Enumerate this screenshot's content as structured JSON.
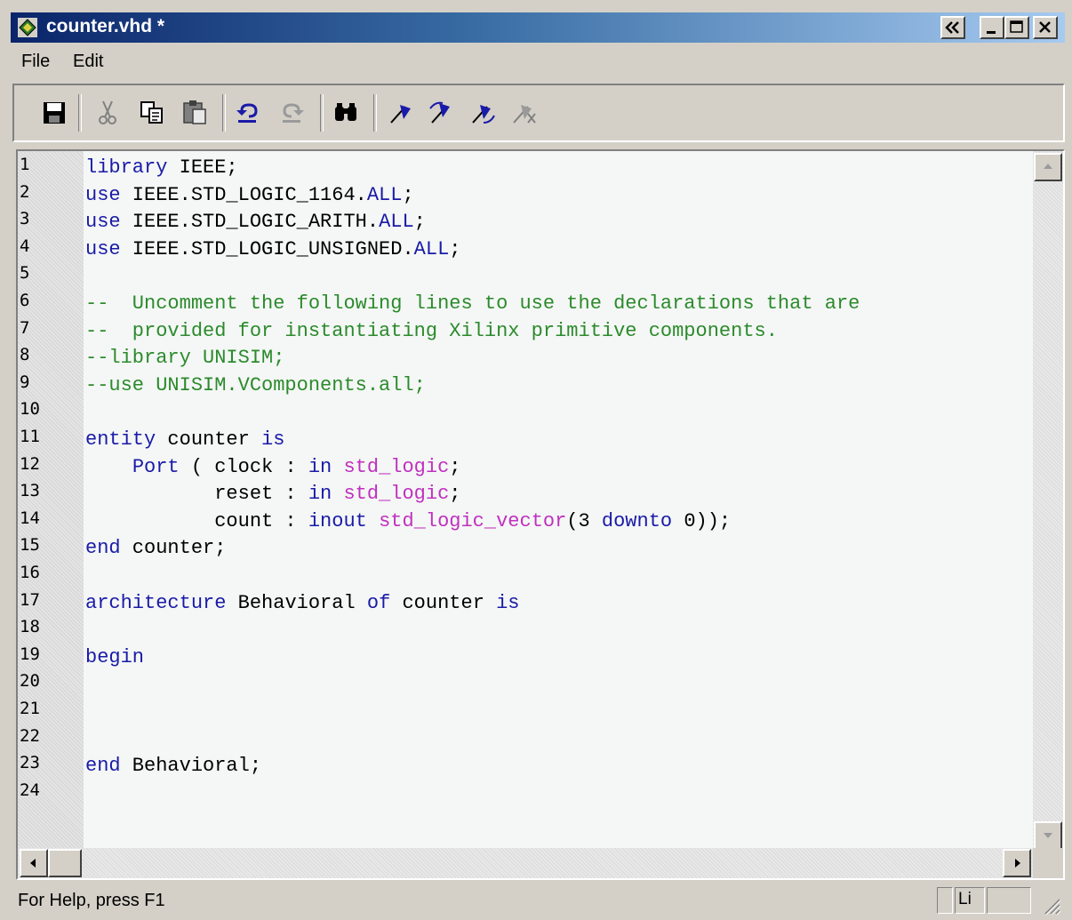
{
  "window": {
    "title": "counter.vhd *",
    "buttons": [
      "collapse",
      "minimize",
      "maximize",
      "close"
    ]
  },
  "menu": {
    "items": [
      "File",
      "Edit"
    ]
  },
  "toolbar": {
    "icons": [
      "save-icon",
      "cut-icon",
      "copy-icon",
      "paste-icon",
      "undo-icon",
      "redo-icon",
      "find-icon",
      "toggle-bookmark-icon",
      "next-bookmark-icon",
      "previous-bookmark-icon",
      "clear-bookmarks-icon"
    ]
  },
  "editor": {
    "line_numbers": [
      "1",
      "2",
      "3",
      "4",
      "5",
      "6",
      "7",
      "8",
      "9",
      "10",
      "11",
      "12",
      "13",
      "14",
      "15",
      "16",
      "17",
      "18",
      "19",
      "20",
      "21",
      "22",
      "23",
      "24"
    ],
    "lines": [
      [
        {
          "t": "kw",
          "v": "library"
        },
        {
          "t": "plain",
          "v": " IEEE;"
        }
      ],
      [
        {
          "t": "kw",
          "v": "use"
        },
        {
          "t": "plain",
          "v": " IEEE.STD_LOGIC_1164."
        },
        {
          "t": "kw",
          "v": "ALL"
        },
        {
          "t": "plain",
          "v": ";"
        }
      ],
      [
        {
          "t": "kw",
          "v": "use"
        },
        {
          "t": "plain",
          "v": " IEEE.STD_LOGIC_ARITH."
        },
        {
          "t": "kw",
          "v": "ALL"
        },
        {
          "t": "plain",
          "v": ";"
        }
      ],
      [
        {
          "t": "kw",
          "v": "use"
        },
        {
          "t": "plain",
          "v": " IEEE.STD_LOGIC_UNSIGNED."
        },
        {
          "t": "kw",
          "v": "ALL"
        },
        {
          "t": "plain",
          "v": ";"
        }
      ],
      [],
      [
        {
          "t": "cmt",
          "v": "--  Uncomment the following lines to use the declarations that are"
        }
      ],
      [
        {
          "t": "cmt",
          "v": "--  provided for instantiating Xilinx primitive components."
        }
      ],
      [
        {
          "t": "cmt",
          "v": "--library UNISIM;"
        }
      ],
      [
        {
          "t": "cmt",
          "v": "--use UNISIM.VComponents.all;"
        }
      ],
      [],
      [
        {
          "t": "kw",
          "v": "entity"
        },
        {
          "t": "plain",
          "v": " counter "
        },
        {
          "t": "kw",
          "v": "is"
        }
      ],
      [
        {
          "t": "plain",
          "v": "    "
        },
        {
          "t": "kw",
          "v": "Port"
        },
        {
          "t": "plain",
          "v": " ( clock : "
        },
        {
          "t": "kw",
          "v": "in"
        },
        {
          "t": "plain",
          "v": " "
        },
        {
          "t": "type",
          "v": "std_logic"
        },
        {
          "t": "plain",
          "v": ";"
        }
      ],
      [
        {
          "t": "plain",
          "v": "           reset : "
        },
        {
          "t": "kw",
          "v": "in"
        },
        {
          "t": "plain",
          "v": " "
        },
        {
          "t": "type",
          "v": "std_logic"
        },
        {
          "t": "plain",
          "v": ";"
        }
      ],
      [
        {
          "t": "plain",
          "v": "           count : "
        },
        {
          "t": "kw",
          "v": "inout"
        },
        {
          "t": "plain",
          "v": " "
        },
        {
          "t": "type",
          "v": "std_logic_vector"
        },
        {
          "t": "plain",
          "v": "(3 "
        },
        {
          "t": "kw",
          "v": "downto"
        },
        {
          "t": "plain",
          "v": " 0));"
        }
      ],
      [
        {
          "t": "kw",
          "v": "end"
        },
        {
          "t": "plain",
          "v": " counter;"
        }
      ],
      [],
      [
        {
          "t": "kw",
          "v": "architecture"
        },
        {
          "t": "plain",
          "v": " Behavioral "
        },
        {
          "t": "kw",
          "v": "of"
        },
        {
          "t": "plain",
          "v": " counter "
        },
        {
          "t": "kw",
          "v": "is"
        }
      ],
      [],
      [
        {
          "t": "kw",
          "v": "begin"
        }
      ],
      [],
      [],
      [],
      [
        {
          "t": "kw",
          "v": "end"
        },
        {
          "t": "plain",
          "v": " Behavioral;"
        }
      ],
      []
    ]
  },
  "status": {
    "text": "For Help, press F1",
    "pane_text": "Li"
  },
  "colors": {
    "keyword": "#1a1aa8",
    "type": "#c030c0",
    "comment": "#2c8a2c",
    "title_start": "#0a246a",
    "title_end": "#a6caf0"
  }
}
